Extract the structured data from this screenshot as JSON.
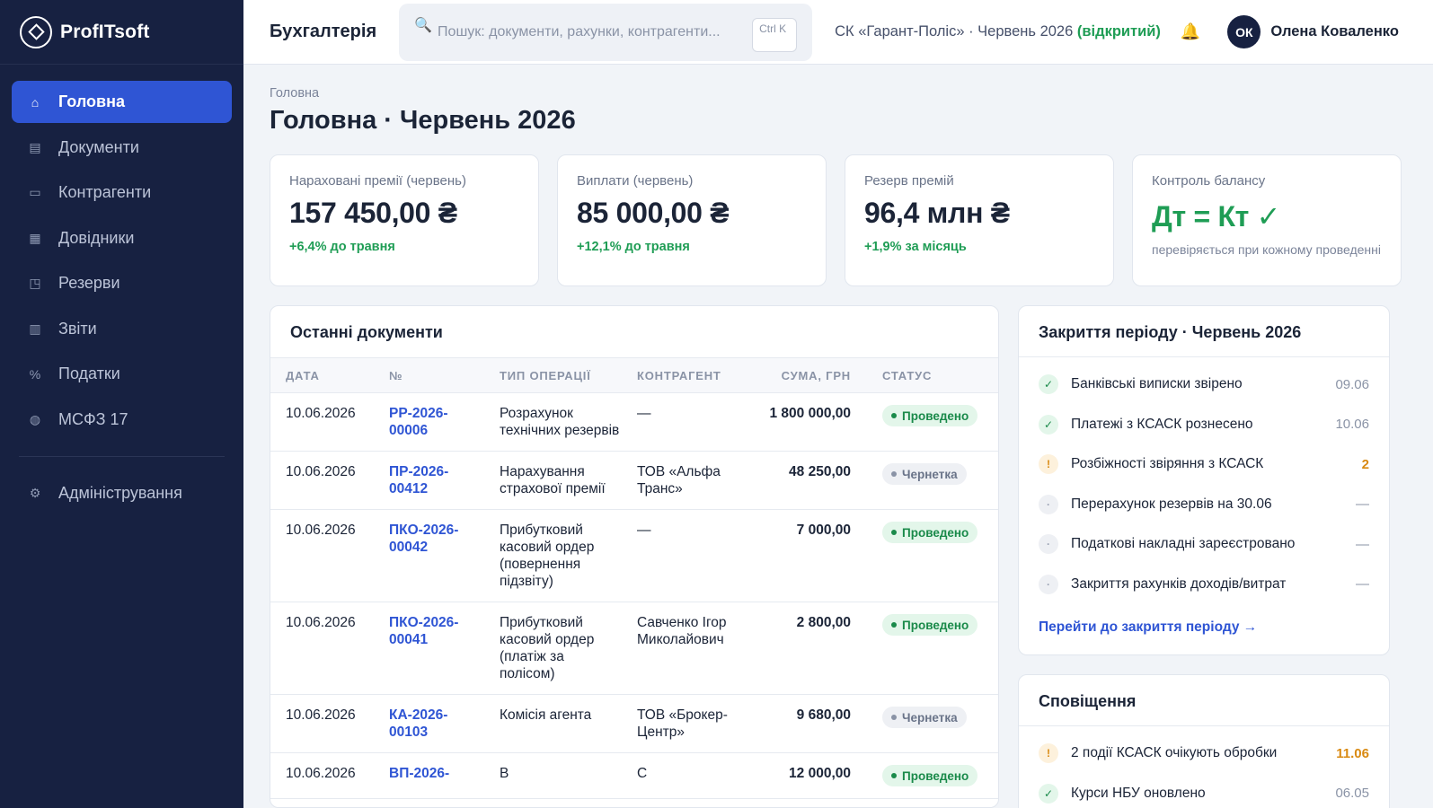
{
  "app": {
    "logo": "ProfITsoft",
    "section_title": "Бухгалтерія"
  },
  "sidebar": {
    "items": [
      {
        "label": "Головна",
        "icon": "home-icon",
        "glyph": "⌂",
        "active": true
      },
      {
        "label": "Документи",
        "icon": "documents-icon",
        "glyph": "▤",
        "active": false
      },
      {
        "label": "Контрагенти",
        "icon": "contacts-icon",
        "glyph": "▭",
        "active": false
      },
      {
        "label": "Довідники",
        "icon": "grid-icon",
        "glyph": "▦",
        "active": false
      },
      {
        "label": "Резерви",
        "icon": "reserve-icon",
        "glyph": "◳",
        "active": false
      },
      {
        "label": "Звіти",
        "icon": "reports-icon",
        "glyph": "▥",
        "active": false
      },
      {
        "label": "Податки",
        "icon": "percent-icon",
        "glyph": "%",
        "active": false
      },
      {
        "label": "МСФЗ 17",
        "icon": "globe-icon",
        "glyph": "◍",
        "active": false
      }
    ],
    "admin": {
      "label": "Адміністрування",
      "icon": "gear-icon",
      "glyph": "⚙"
    }
  },
  "topbar": {
    "search_placeholder": "Пошук: документи, рахунки, контрагенти...",
    "search_shortcut": "Ctrl K",
    "company": "СК «Гарант-Поліс» · Червень 2026",
    "period_status": "(відкритий)",
    "user_initials": "ОК",
    "user_name": "Олена Коваленко"
  },
  "page": {
    "breadcrumb": "Головна",
    "title": "Головна · Червень 2026"
  },
  "kpis": [
    {
      "label": "Нараховані премії (червень)",
      "value": "157 450,00 ₴",
      "delta": "+6,4% до травня"
    },
    {
      "label": "Виплати (червень)",
      "value": "85 000,00 ₴",
      "delta": "+12,1% до травня"
    },
    {
      "label": "Резерв премій",
      "value": "96,4 млн ₴",
      "delta": "+1,9% за місяць"
    },
    {
      "label": "Контроль балансу",
      "value": "Дт = Кт ✓",
      "note": "перевіряється при кожному проведенні"
    }
  ],
  "documents": {
    "title": "Останні документи",
    "columns": [
      "ДАТА",
      "№",
      "ТИП ОПЕРАЦІЇ",
      "КОНТРАГЕНТ",
      "СУМА, ГРН",
      "СТАТУС"
    ],
    "rows": [
      {
        "date": "10.06.2026",
        "number": "РР-2026-00006",
        "type": "Розрахунок технічних резервів",
        "party": "—",
        "amount": "1 800 000,00",
        "status": "Проведено",
        "status_kind": "done"
      },
      {
        "date": "10.06.2026",
        "number": "ПР-2026-00412",
        "type": "Нарахування страхової премії",
        "party": "ТОВ «Альфа Транс»",
        "amount": "48 250,00",
        "status": "Чернетка",
        "status_kind": "draft"
      },
      {
        "date": "10.06.2026",
        "number": "ПКО-2026-00042",
        "type": "Прибутковий касовий ордер (повернення підзвіту)",
        "party": "—",
        "amount": "7 000,00",
        "status": "Проведено",
        "status_kind": "done"
      },
      {
        "date": "10.06.2026",
        "number": "ПКО-2026-00041",
        "type": "Прибутковий касовий ордер (платіж за полісом)",
        "party": "Савченко Ігор Миколайович",
        "amount": "2 800,00",
        "status": "Проведено",
        "status_kind": "done"
      },
      {
        "date": "10.06.2026",
        "number": "КА-2026-00103",
        "type": "Комісія агента",
        "party": "ТОВ «Брокер-Центр»",
        "amount": "9 680,00",
        "status": "Чернетка",
        "status_kind": "draft"
      },
      {
        "date": "10.06.2026",
        "number": "ВП-2026-",
        "type": "В",
        "party": "С",
        "amount": "12 000,00",
        "status": "Проведено",
        "status_kind": "done"
      }
    ]
  },
  "closing": {
    "title": "Закриття періоду · Червень 2026",
    "items": [
      {
        "label": "Банківські виписки звірено",
        "value": "09.06",
        "kind": "ok",
        "glyph": "✓"
      },
      {
        "label": "Платежі з КСАСК рознесено",
        "value": "10.06",
        "kind": "ok",
        "glyph": "✓"
      },
      {
        "label": "Розбіжності звіряння з КСАСК",
        "value": "2",
        "kind": "warn",
        "glyph": "!"
      },
      {
        "label": "Перерахунок резервів на 30.06",
        "value": "—",
        "kind": "pending",
        "glyph": "·"
      },
      {
        "label": "Податкові накладні зареєстровано",
        "value": "—",
        "kind": "pending",
        "glyph": "·"
      },
      {
        "label": "Закриття рахунків доходів/витрат",
        "value": "—",
        "kind": "pending",
        "glyph": "·"
      }
    ],
    "link": "Перейти до закриття періоду →"
  },
  "notifications": {
    "title": "Сповіщення",
    "items": [
      {
        "label": "2 події КСАСК очікують обробки",
        "value": "11.06",
        "kind": "warn",
        "glyph": "!"
      },
      {
        "label": "Курси НБУ оновлено",
        "value": "06.05",
        "kind": "ok",
        "glyph": "✓"
      }
    ]
  },
  "colors": {
    "sidebar_bg": "#172141",
    "accent": "#2f55d4",
    "success": "#1f9d55",
    "warning": "#d98a12"
  }
}
